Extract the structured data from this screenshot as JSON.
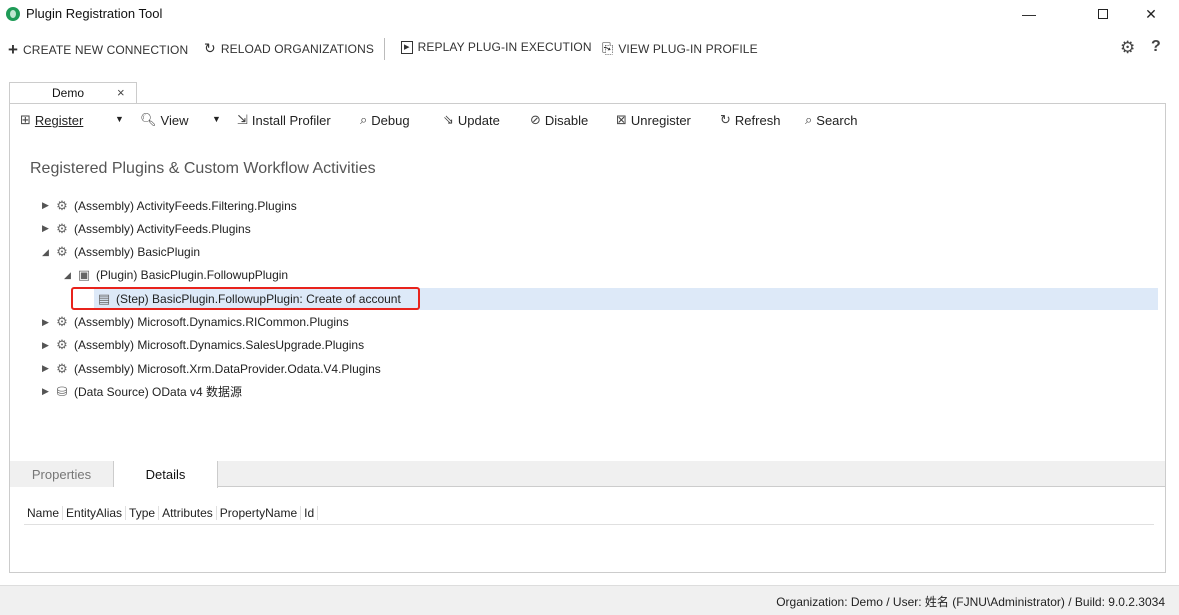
{
  "window": {
    "title": "Plugin Registration Tool",
    "minimize": "—",
    "close": "✕"
  },
  "commands": {
    "create": "CREATE NEW CONNECTION",
    "reload": "RELOAD ORGANIZATIONS",
    "replay": "REPLAY PLUG-IN EXECUTION",
    "view_profile": "VIEW PLUG-IN PROFILE",
    "settings_icon": "gear-icon",
    "help": "?"
  },
  "doc_tab": {
    "label": "Demo",
    "close": "×"
  },
  "toolbar": {
    "register": "Register",
    "view": "View",
    "install_profiler": "Install Profiler",
    "debug": "Debug",
    "update": "Update",
    "disable": "Disable",
    "unregister": "Unregister",
    "refresh": "Refresh",
    "search": "Search"
  },
  "section_title": "Registered Plugins & Custom Workflow Activities",
  "tree": [
    {
      "label": "(Assembly) ActivityFeeds.Filtering.Plugins",
      "level": 0,
      "expanded": false,
      "icon": "assembly-icon"
    },
    {
      "label": "(Assembly) ActivityFeeds.Plugins",
      "level": 0,
      "expanded": false,
      "icon": "assembly-icon"
    },
    {
      "label": "(Assembly) BasicPlugin",
      "level": 0,
      "expanded": true,
      "icon": "assembly-icon"
    },
    {
      "label": "(Plugin) BasicPlugin.FollowupPlugin",
      "level": 1,
      "expanded": true,
      "icon": "plugin-icon"
    },
    {
      "label": "(Step) BasicPlugin.FollowupPlugin: Create of account",
      "level": 2,
      "selected": true,
      "icon": "step-icon"
    },
    {
      "label": "(Assembly) Microsoft.Dynamics.RICommon.Plugins",
      "level": 0,
      "expanded": false,
      "icon": "assembly-icon"
    },
    {
      "label": "(Assembly) Microsoft.Dynamics.SalesUpgrade.Plugins",
      "level": 0,
      "expanded": false,
      "icon": "assembly-icon"
    },
    {
      "label": "(Assembly) Microsoft.Xrm.DataProvider.Odata.V4.Plugins",
      "level": 0,
      "expanded": false,
      "icon": "assembly-icon"
    },
    {
      "label": "(Data Source) OData v4 数据源",
      "level": 0,
      "expanded": false,
      "icon": "datasource-icon"
    }
  ],
  "bottom_tabs": {
    "properties": "Properties",
    "details": "Details"
  },
  "grid_columns": [
    "Name",
    "EntityAlias",
    "Type",
    "Attributes",
    "PropertyName",
    "Id"
  ],
  "status": "Organization: Demo / User: 姓名 (FJNU\\Administrator) / Build: 9.0.2.3034",
  "colors": {
    "selection": "#dde9f8",
    "highlight_border": "#e8231c",
    "logo": "#1f9b57"
  }
}
